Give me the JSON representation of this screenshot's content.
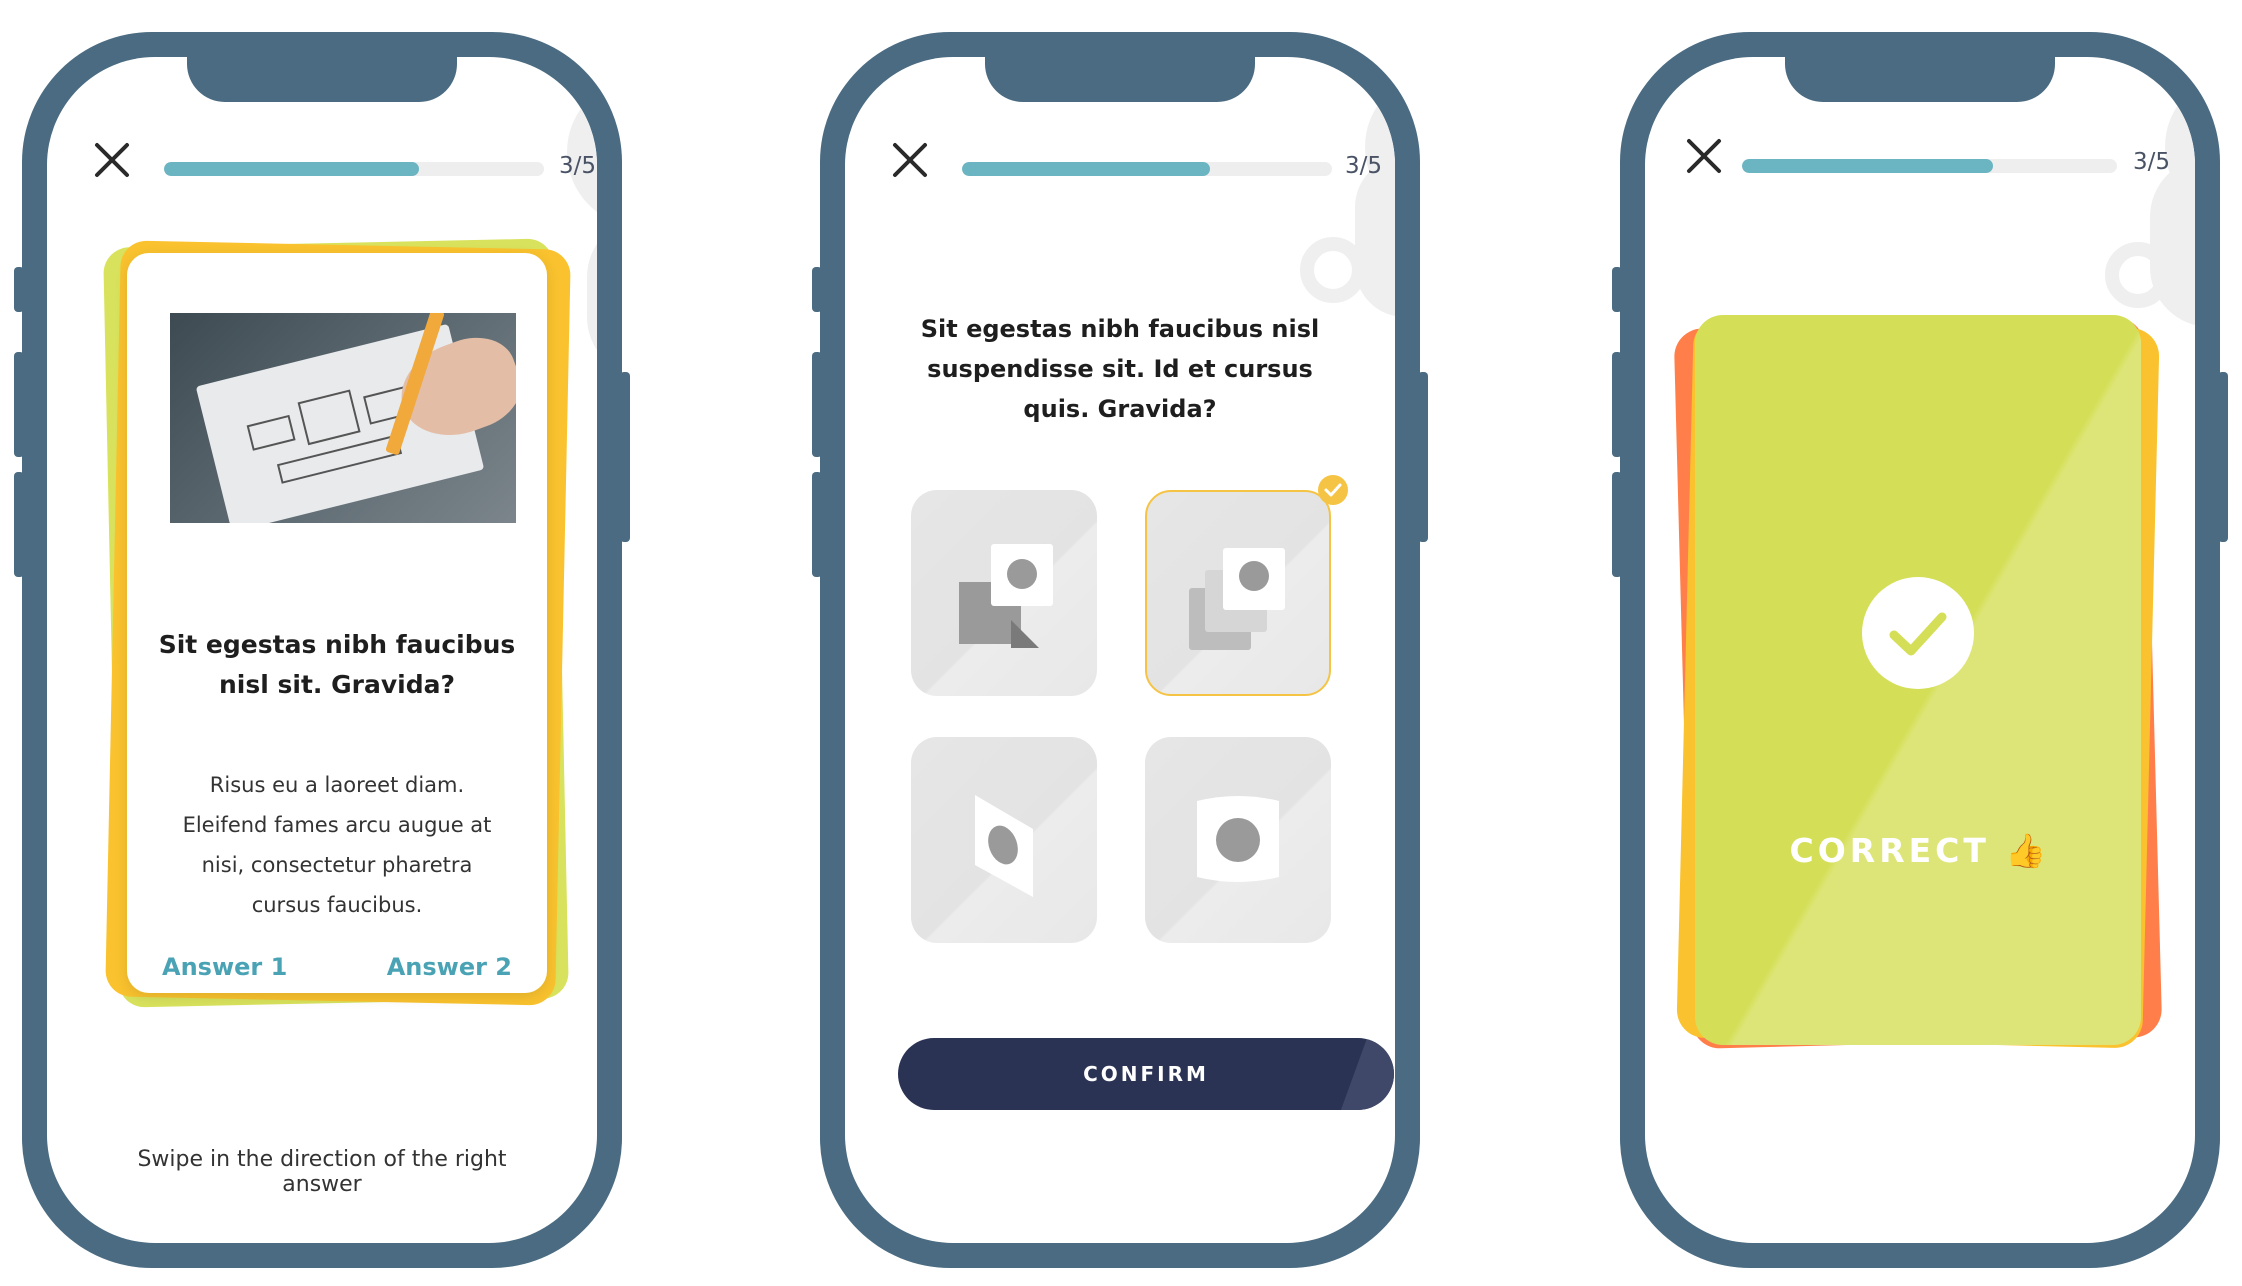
{
  "progress": {
    "text": "3/5",
    "value": 0.67
  },
  "screen1": {
    "card_title": "Sit egestas nibh faucibus nisl sit. Gravida?",
    "card_body": "Risus eu a laoreet diam. Eleifend fames arcu augue at nisi, consectetur pharetra cursus faucibus.",
    "answer_left": "Answer 1",
    "answer_right": "Answer 2",
    "hint": "Swipe in the direction of the right answer"
  },
  "screen2": {
    "question": "Sit egestas nibh faucibus nisl suspendisse sit. Id et cursus quis. Gravida?",
    "confirm_label": "CONFIRM",
    "selected_option": 2
  },
  "screen3": {
    "result_label": "CORRECT",
    "result_emoji": "👍"
  },
  "colors": {
    "frame": "#4a6b81",
    "progress": "#6bb5c2",
    "accent_teal": "#4aa3b5",
    "selected_yellow": "#f5c445",
    "confirm_navy": "#2a3354",
    "correct_green": "#d4df57"
  }
}
